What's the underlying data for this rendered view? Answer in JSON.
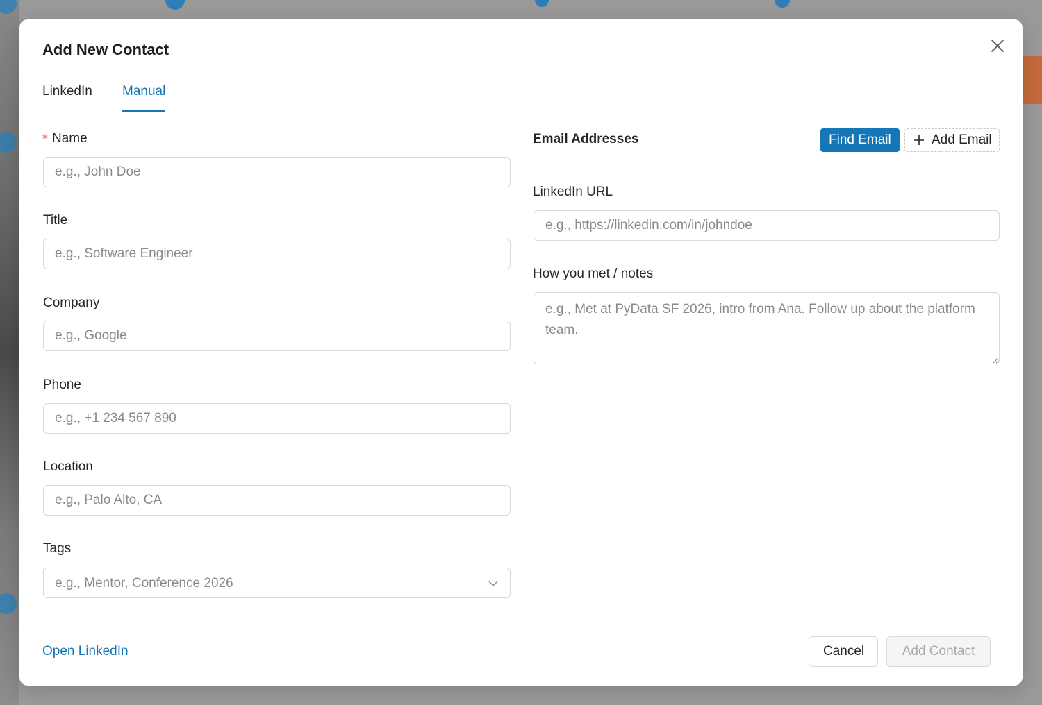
{
  "modal": {
    "title": "Add New Contact"
  },
  "tabs": [
    {
      "label": "LinkedIn",
      "active": false
    },
    {
      "label": "Manual",
      "active": true
    }
  ],
  "left_fields": {
    "name": {
      "label": "Name",
      "required": true,
      "placeholder": "e.g., John Doe",
      "value": ""
    },
    "title": {
      "label": "Title",
      "placeholder": "e.g., Software Engineer",
      "value": ""
    },
    "company": {
      "label": "Company",
      "placeholder": "e.g., Google",
      "value": ""
    },
    "phone": {
      "label": "Phone",
      "placeholder": "e.g., +1 234 567 890",
      "value": ""
    },
    "location": {
      "label": "Location",
      "placeholder": "e.g., Palo Alto, CA",
      "value": ""
    },
    "tags": {
      "label": "Tags",
      "placeholder": "e.g., Mentor, Conference 2026"
    }
  },
  "right_fields": {
    "email_heading": "Email Addresses",
    "find_email_label": "Find Email",
    "add_email_label": "Add Email",
    "linkedin_url": {
      "label": "LinkedIn URL",
      "placeholder": "e.g., https://linkedin.com/in/johndoe",
      "value": ""
    },
    "notes": {
      "label": "How you met / notes",
      "placeholder": "e.g., Met at PyData SF 2026, intro from Ana. Follow up about the platform team.",
      "value": ""
    }
  },
  "footer": {
    "open_linkedin_label": "Open LinkedIn",
    "cancel_label": "Cancel",
    "add_contact_label": "Add Contact"
  },
  "colors": {
    "accent": "#1677b8",
    "required": "#ff4d4f",
    "border": "#d9d9d9",
    "placeholder": "#8a8a8a"
  },
  "icons": {
    "close": "close-icon",
    "chevron": "chevron-down-icon",
    "plus": "plus-icon"
  }
}
